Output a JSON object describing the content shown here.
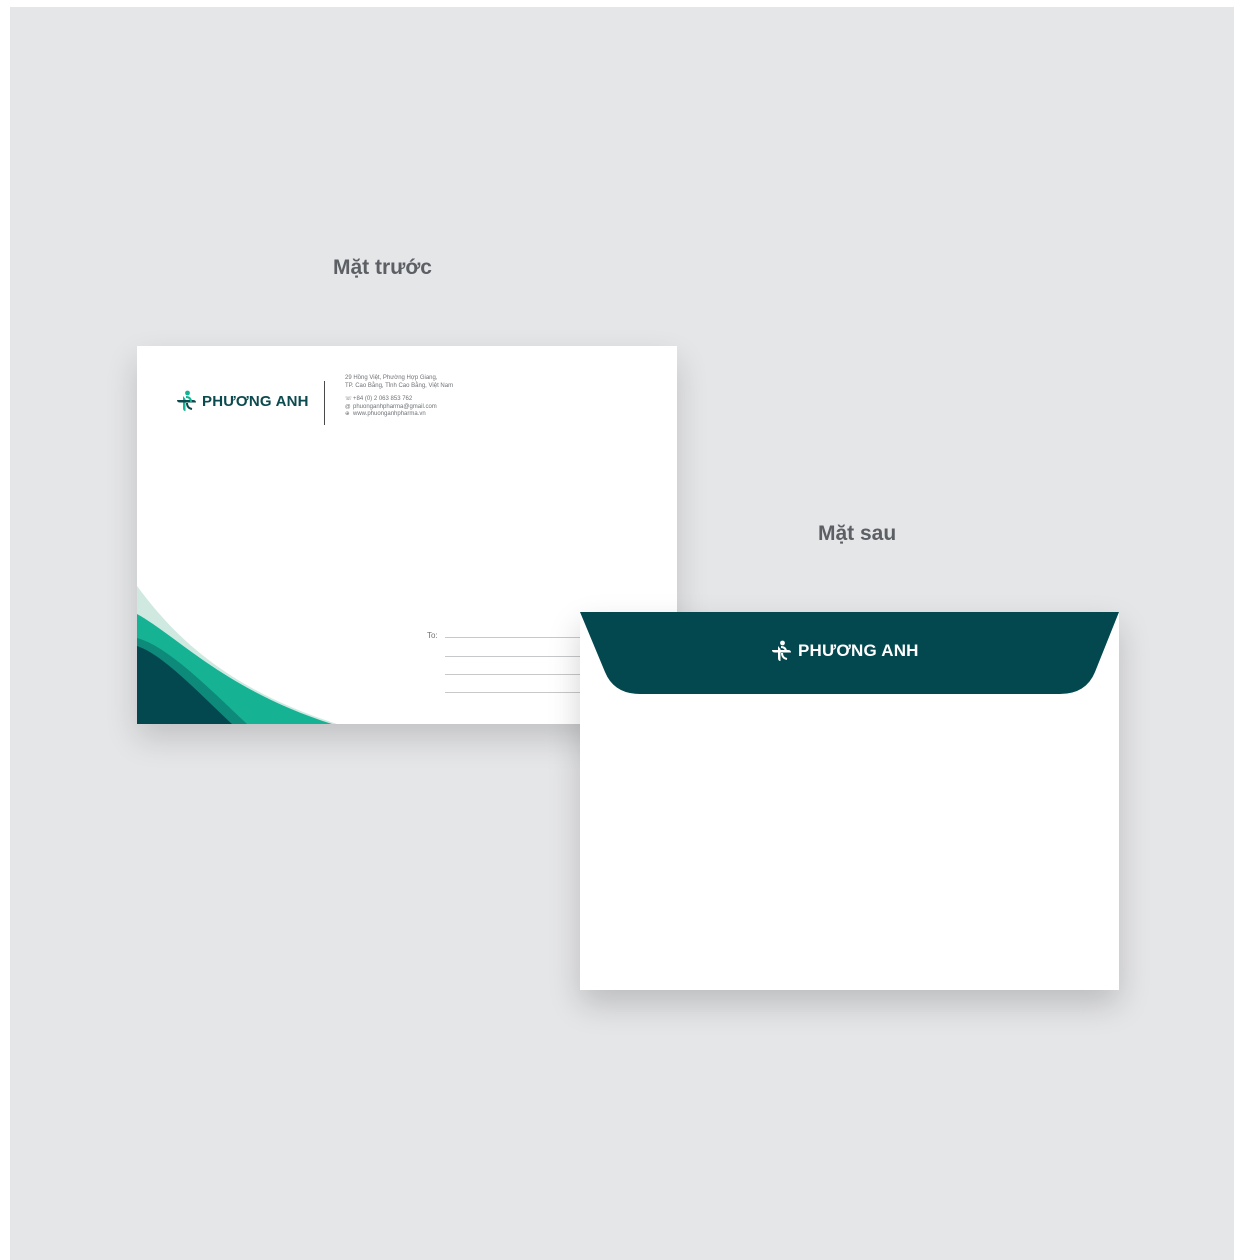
{
  "captions": {
    "front": "Mặt trước",
    "back": "Mặt sau"
  },
  "brand": {
    "name": "PHƯƠNG ANH",
    "colors": {
      "dark_teal": "#03484f",
      "teal": "#15b394",
      "light_teal": "#bfe3d8",
      "background": "#e5e6e8"
    }
  },
  "contact": {
    "address_line1": "29 Hồng Việt, Phường Hợp Giang,",
    "address_line2": "TP. Cao Bằng, Tỉnh Cao Bằng, Việt Nam",
    "phone_icon": "phone-icon",
    "phone": "+84 (0) 2 063 853 762",
    "email_icon": "at-icon",
    "email": "phuonganhpharma@gmail.com",
    "web_icon": "globe-icon",
    "website": "www.phuonganhpharma.vn"
  },
  "address_block": {
    "to_label": "To:"
  }
}
